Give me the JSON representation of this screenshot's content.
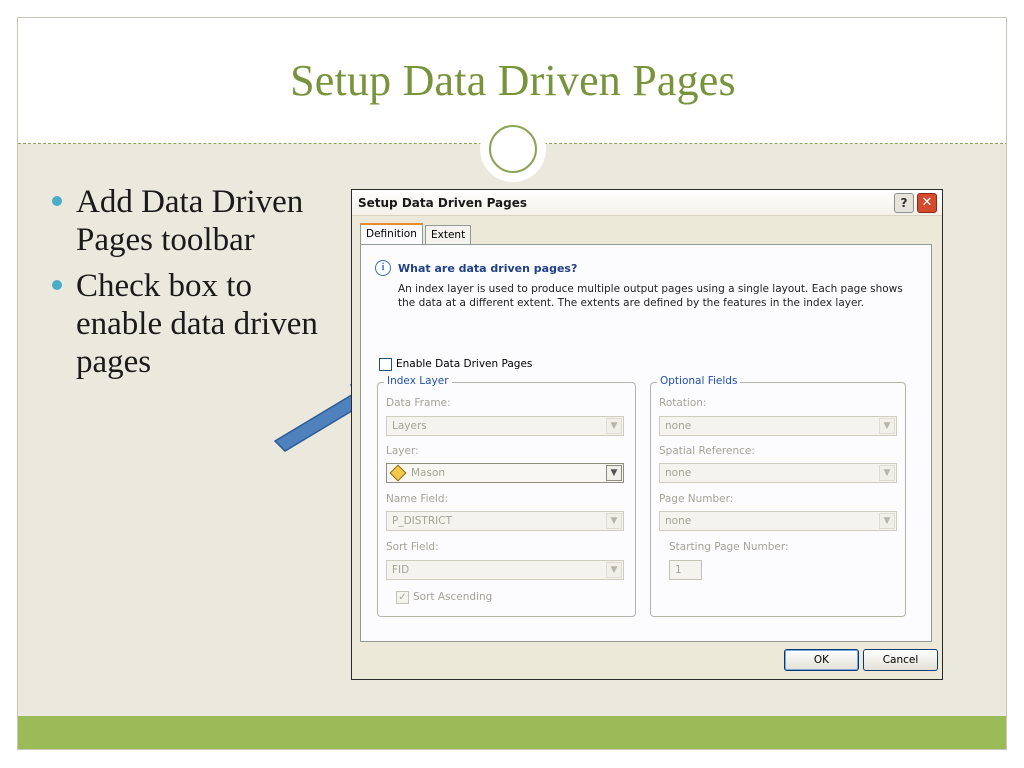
{
  "slide": {
    "title": "Setup Data Driven Pages",
    "bullets": [
      "Add Data Driven Pages toolbar",
      "Check box to enable data driven pages"
    ]
  },
  "dialog": {
    "title": "Setup Data Driven Pages",
    "help_button": "?",
    "close_button": "✕",
    "tabs": [
      "Definition",
      "Extent"
    ],
    "info": {
      "heading": "What are data driven pages?",
      "text": "An index layer is used to produce multiple output pages using a single layout.  Each page shows the data at a different extent.  The extents are defined by the features in the index layer."
    },
    "enable_label": "Enable Data Driven Pages",
    "index_layer": {
      "legend": "Index Layer",
      "data_frame_label": "Data Frame:",
      "data_frame_value": "Layers",
      "layer_label": "Layer:",
      "layer_value": "Mason",
      "name_field_label": "Name Field:",
      "name_field_value": "P_DISTRICT",
      "sort_field_label": "Sort Field:",
      "sort_field_value": "FID",
      "sort_ascending_label": "Sort Ascending"
    },
    "optional_fields": {
      "legend": "Optional Fields",
      "rotation_label": "Rotation:",
      "rotation_value": "none",
      "spatial_ref_label": "Spatial Reference:",
      "spatial_ref_value": "none",
      "page_number_label": "Page Number:",
      "page_number_value": "none",
      "starting_page_label": "Starting Page Number:",
      "starting_page_value": "1"
    },
    "ok_label": "OK",
    "cancel_label": "Cancel"
  },
  "colors": {
    "title_green": "#77933c",
    "footer_green": "#9bbb59",
    "bullet_blue": "#4bacc6",
    "arrow_blue": "#4f81bd"
  },
  "icons": [
    "help-icon",
    "close-icon",
    "info-icon",
    "layer-icon",
    "chevron-down-icon"
  ]
}
